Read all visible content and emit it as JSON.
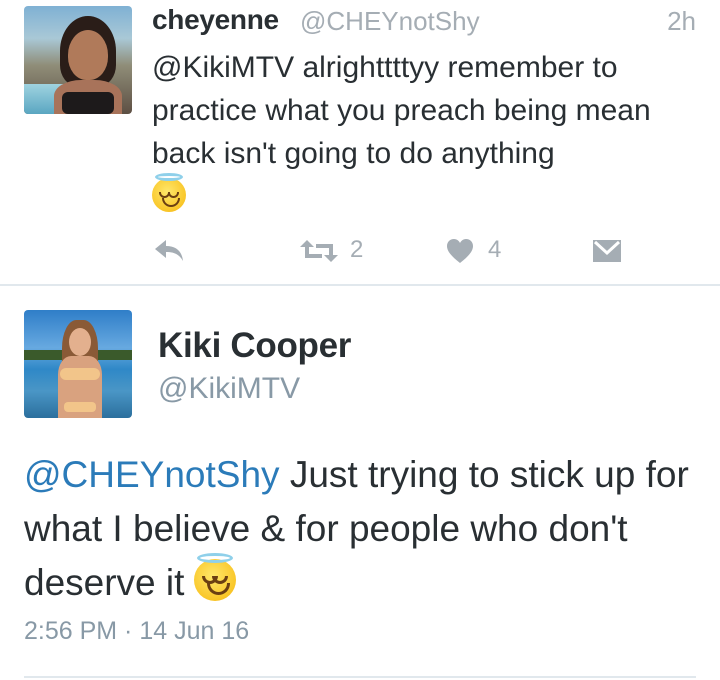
{
  "reply_tweet": {
    "display_name": "cheyenne",
    "handle": "@CHEYnotShy",
    "time_ago": "2h",
    "text": "@KikiMTV alrighttttyy remember to practice what you preach   being mean back isn't going to do anything",
    "emoji": "smiling-face-with-halo",
    "actions": {
      "reply_icon": "reply-icon",
      "retweet_icon": "retweet-icon",
      "retweet_count": "2",
      "like_icon": "heart-icon",
      "like_count": "4",
      "dm_icon": "direct-message-icon"
    }
  },
  "main_tweet": {
    "display_name": "Kiki Cooper",
    "handle": "@KikiMTV",
    "mention": "@CHEYnotShy",
    "text": " Just trying to stick up for what I believe & for people who don't deserve it",
    "emoji": "smiling-face-with-halo",
    "timestamp": "2:56 PM · 14 Jun 16"
  },
  "colors": {
    "text": "#292f33",
    "muted": "#a5adb4",
    "link": "#2b7bb9",
    "divider": "#e1e8ed"
  }
}
